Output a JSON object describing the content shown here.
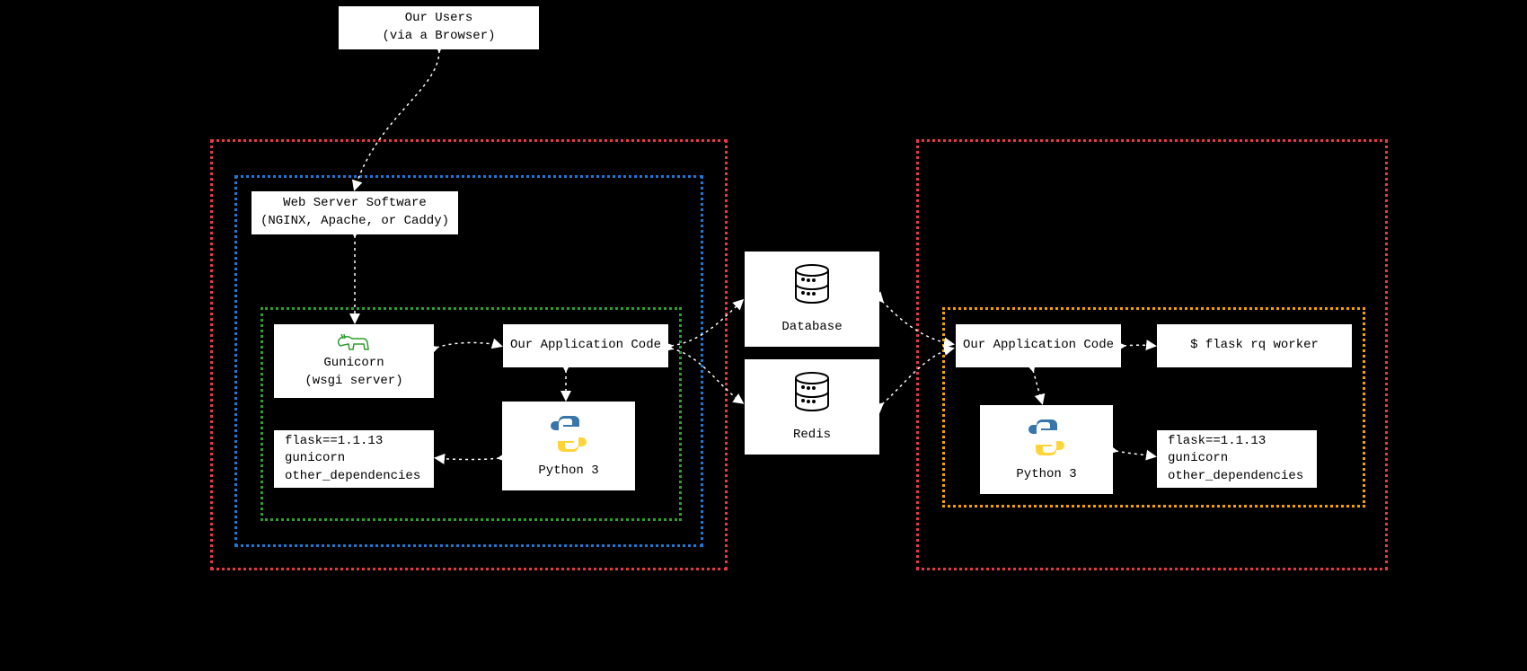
{
  "users": {
    "line1": "Our Users",
    "line2": "(via a Browser)"
  },
  "webserver": {
    "line1": "Web Server Software",
    "line2": "(NGINX, Apache, or Caddy)"
  },
  "gunicorn": {
    "name": "Gunicorn",
    "sub": "(wsgi server)"
  },
  "appcode": "Our Application Code",
  "python": "Python 3",
  "deps": {
    "l1": "flask==1.1.13",
    "l2": "gunicorn",
    "l3": "other_dependencies"
  },
  "database": "Database",
  "redis": "Redis",
  "worker_cmd": "$ flask rq worker"
}
